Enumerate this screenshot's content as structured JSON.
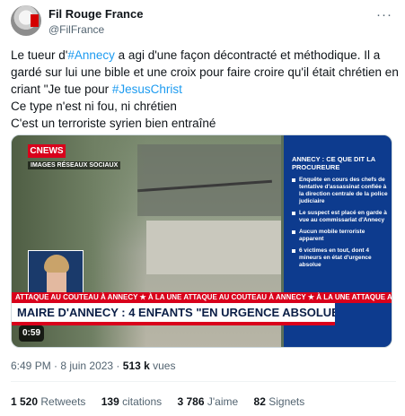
{
  "author": {
    "name": "Fil Rouge France",
    "handle": "@FilFrance"
  },
  "menu_icon": "more-horizontal-icon",
  "tweet": {
    "line1_pre": "Le tueur d'",
    "line1_tag": "#Annecy",
    "line1_post": " a agi d'une façon décontracté et méthodique. Il a",
    "line2": "gardé sur lui une bible et une croix pour faire croire qu'il était chrétien en",
    "line3_pre": "criant \"Je tue pour ",
    "line3_tag": "#JesusChrist",
    "line4": "Ce type n'est ni fou, ni chrétien",
    "line5": "C'est un terroriste syrien bien entraîné"
  },
  "video": {
    "channel": "CNEWS",
    "source_label": "IMAGES RÉSEAUX SOCIAUX",
    "sidebar_title": "ANNECY : CE QUE DIT LA PROCUREURE",
    "sidebar_items": [
      "Enquête en cours des chefs de tentative d'assassinat confiée à la direction centrale de la police judiciaire",
      "Le suspect est placé en garde à vue au commissariat d'Annecy",
      "Aucun mobile terroriste apparent",
      "6 victimes en tout, dont 4 mineurs en état d'urgence absolue"
    ],
    "ticker": "ATTAQUE AU COUTEAU À ANNECY   ★ À LA UNE   ATTAQUE AU COUTEAU À ANNECY   ★ À LA UNE   ATTAQUE AU COUTEAU À ANNECY",
    "headline": "MAIRE D'ANNECY : 4 ENFANTS \"EN URGENCE ABSOLUE\"",
    "duration": "0:59"
  },
  "meta": {
    "time": "6:49 PM",
    "sep1": " · ",
    "date": "8 juin 2023",
    "sep2": " · ",
    "views_count": "513 k",
    "views_label": " vues"
  },
  "stats": {
    "retweets_count": "1 520",
    "retweets_label": "Retweets",
    "quotes_count": "139",
    "quotes_label": "citations",
    "likes_count": "3 786",
    "likes_label": "J'aime",
    "bookmarks_count": "82",
    "bookmarks_label": "Signets"
  },
  "colors": {
    "link": "#1d9bf0",
    "cnews_red": "#d9001b",
    "sidebar_blue": "#0d3b8e"
  }
}
